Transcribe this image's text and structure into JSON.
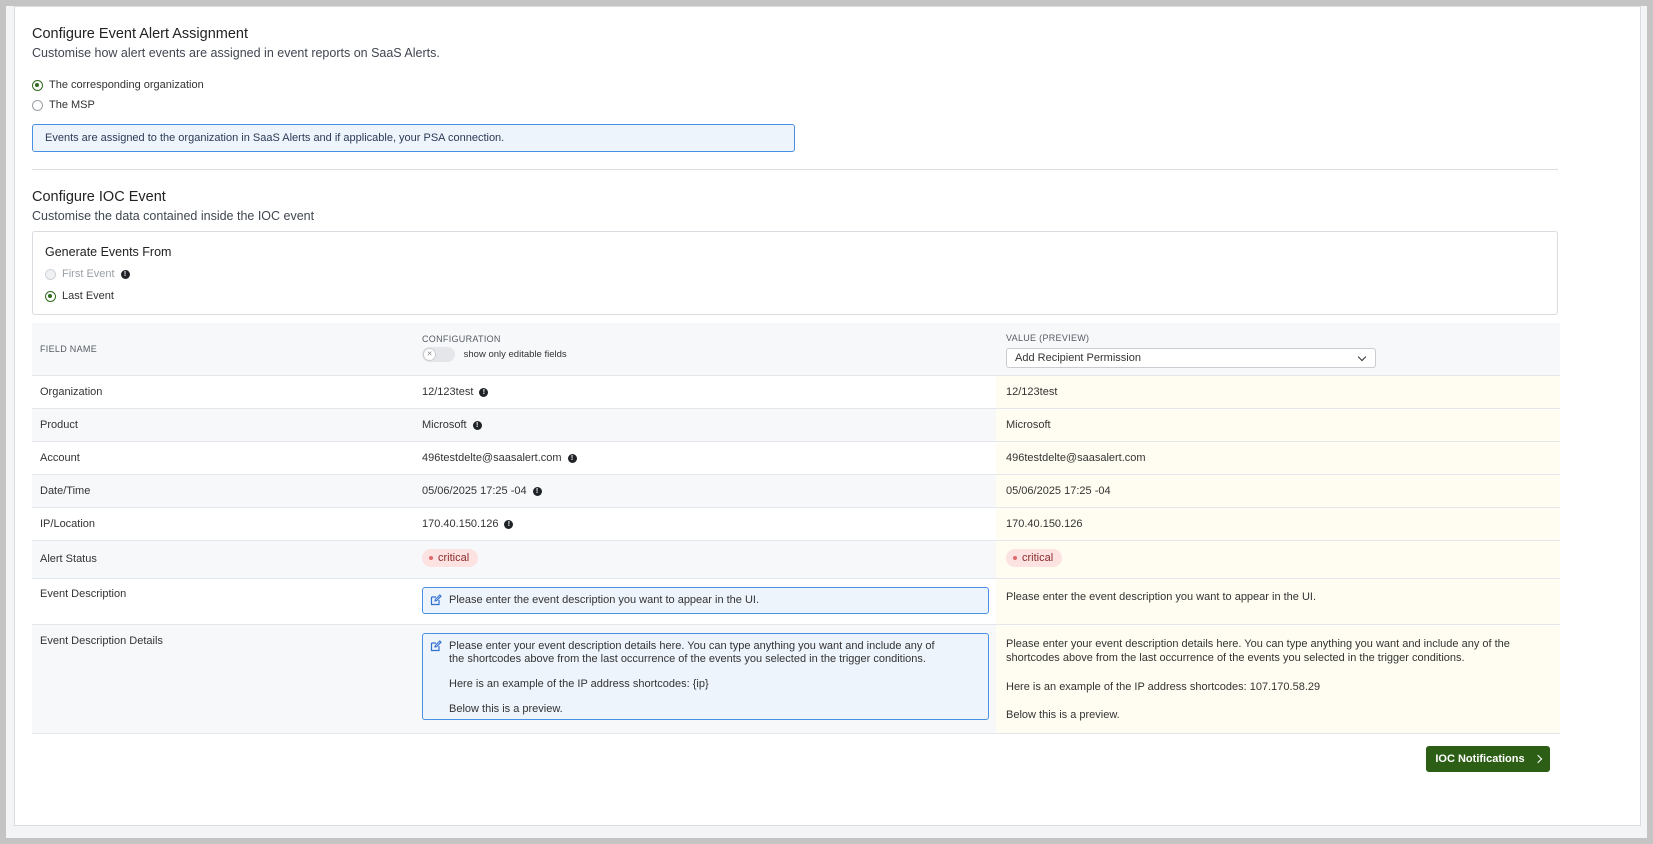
{
  "assignment": {
    "title": "Configure Event Alert Assignment",
    "subtitle": "Customise how alert events are assigned in event reports on SaaS Alerts.",
    "options": [
      {
        "label": "The corresponding organization",
        "selected": true
      },
      {
        "label": "The MSP",
        "selected": false
      }
    ],
    "info": "Events are assigned to the organization in SaaS Alerts and if applicable, your PSA connection."
  },
  "ioc": {
    "title": "Configure IOC Event",
    "subtitle": "Customise the data contained inside the IOC event",
    "generate": {
      "title": "Generate Events From",
      "options": [
        {
          "label": "First Event",
          "selected": false,
          "disabled": true
        },
        {
          "label": "Last Event",
          "selected": true,
          "disabled": false
        }
      ]
    }
  },
  "table": {
    "headers": {
      "field_name": "FIELD NAME",
      "configuration": "CONFIGURATION",
      "value_preview": "VALUE (PREVIEW)"
    },
    "toggle_label": "show only editable fields",
    "preview_select": "Add Recipient Permission",
    "rows": [
      {
        "field": "Organization",
        "config": "12/123test",
        "preview": "12/123test"
      },
      {
        "field": "Product",
        "config": "Microsoft",
        "preview": "Microsoft"
      },
      {
        "field": "Account",
        "config": "496testdelte@saasalert.com",
        "preview": "496testdelte@saasalert.com"
      },
      {
        "field": "Date/Time",
        "config": "05/06/2025 17:25 -04",
        "preview": "05/06/2025 17:25 -04"
      },
      {
        "field": "IP/Location",
        "config": "170.40.150.126",
        "preview": "170.40.150.126"
      },
      {
        "field": "Alert Status",
        "config": "critical",
        "preview": "critical"
      },
      {
        "field": "Event Description",
        "config": "Please enter the event description you want to appear in the UI.",
        "preview": "Please enter the event description you want to appear in the UI."
      },
      {
        "field": "Event Description Details",
        "config": "Please enter your event description details here. You can type anything you want and include any of the shortcodes above from the last occurrence of the events you selected in the trigger conditions.\n\nHere is an example of the IP address shortcodes: {ip}\n\nBelow this is a preview.",
        "preview": "Please enter your event description details here. You can type anything you want and include any of the shortcodes above from the last occurrence of the events you selected in the trigger conditions.\n\nHere is an example of the IP address shortcodes: 107.170.58.29\n\nBelow this is a preview."
      }
    ]
  },
  "footer": {
    "next_button": "IOC Notifications"
  },
  "colors": {
    "accent": "#2d5e16",
    "info_border": "#4a90e2",
    "critical_bg": "#fde2e2",
    "preview_bg": "#fffdf1"
  }
}
